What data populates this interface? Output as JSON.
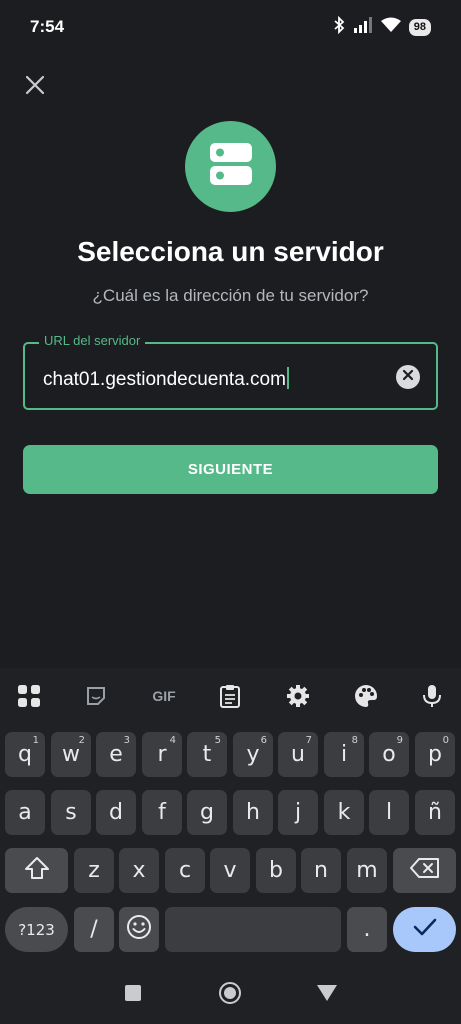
{
  "status": {
    "time": "7:54",
    "battery": "98"
  },
  "screen": {
    "title": "Selecciona un servidor",
    "subtitle": "¿Cuál es la dirección de tu servidor?",
    "url_field": {
      "label": "URL del servidor",
      "value": "chat01.gestiondecuenta.com"
    },
    "next_button": "SIGUIENTE"
  },
  "keyboard": {
    "toolbar": [
      "apps-grid-icon",
      "sticker-icon",
      "gif-icon",
      "clipboard-icon",
      "settings-gear-icon",
      "palette-icon",
      "microphone-icon"
    ],
    "gif_label": "GIF",
    "row1": [
      {
        "key": "q",
        "hint": "1"
      },
      {
        "key": "w",
        "hint": "2"
      },
      {
        "key": "e",
        "hint": "3"
      },
      {
        "key": "r",
        "hint": "4"
      },
      {
        "key": "t",
        "hint": "5"
      },
      {
        "key": "y",
        "hint": "6"
      },
      {
        "key": "u",
        "hint": "7"
      },
      {
        "key": "i",
        "hint": "8"
      },
      {
        "key": "o",
        "hint": "9"
      },
      {
        "key": "p",
        "hint": "0"
      }
    ],
    "row2": [
      "a",
      "s",
      "d",
      "f",
      "g",
      "h",
      "j",
      "k",
      "l",
      "ñ"
    ],
    "row3": [
      "z",
      "x",
      "c",
      "v",
      "b",
      "n",
      "m"
    ],
    "symbols_key": "?123",
    "slash_key": "/",
    "period_key": "."
  },
  "colors": {
    "accent": "#55b989",
    "background": "#1b1d20",
    "keyboard": "#202124",
    "enter_key": "#a8c7fa"
  }
}
